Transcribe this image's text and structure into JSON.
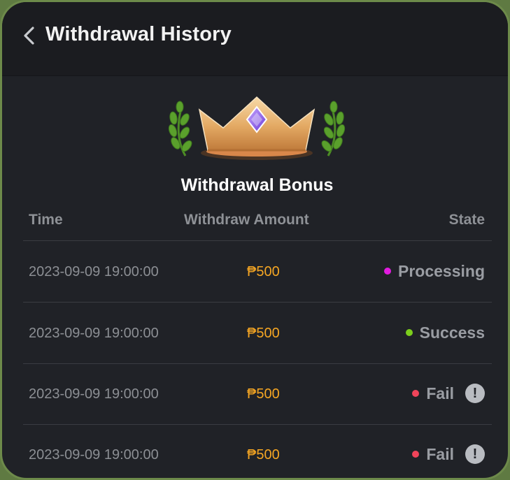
{
  "header": {
    "title": "Withdrawal History"
  },
  "bonus": {
    "title": "Withdrawal Bonus",
    "icon": "crown-icon"
  },
  "table": {
    "columns": [
      "Time",
      "Withdraw Amount",
      "State"
    ],
    "rows": [
      {
        "time": "2023-09-09 19:00:00",
        "amount": "₱500",
        "state": "Processing",
        "dot_color": "#e21be0",
        "has_alert": false
      },
      {
        "time": "2023-09-09 19:00:00",
        "amount": "₱500",
        "state": "Success",
        "dot_color": "#7ccf1c",
        "has_alert": false
      },
      {
        "time": "2023-09-09 19:00:00",
        "amount": "₱500",
        "state": "Fail",
        "dot_color": "#f0445a",
        "has_alert": true,
        "alert_glyph": "!"
      },
      {
        "time": "2023-09-09 19:00:00",
        "amount": "₱500",
        "state": "Fail",
        "dot_color": "#f0445a",
        "has_alert": true,
        "alert_glyph": "!"
      }
    ]
  },
  "colors": {
    "background": "#202227",
    "header": "#1b1c20",
    "amount": "#f5a623",
    "muted_text": "#8c8f94"
  }
}
